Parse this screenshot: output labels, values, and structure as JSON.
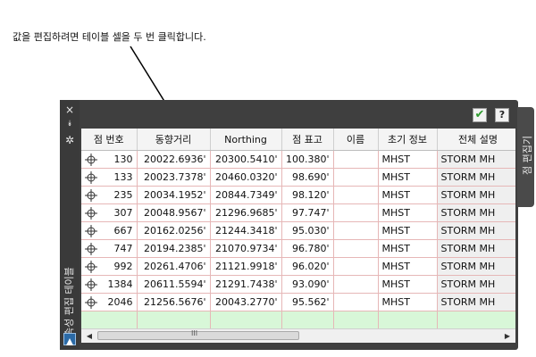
{
  "callout": {
    "text": "값을 편집하려면 테이블 셀을 두 번 클릭합니다."
  },
  "palette": {
    "title": "속성 편집 테이블",
    "side_tab_label": "점 편집기",
    "close_icon": "×",
    "pin_icon": "⯯",
    "settings_icon": "✲"
  },
  "toolbar": {
    "apply_icon": "check-icon",
    "help_label": "?"
  },
  "columns": [
    "점 번호",
    "동향거리",
    "Northing",
    "점 표고",
    "이름",
    "초기 정보",
    "전체 설명"
  ],
  "rows": [
    [
      "130",
      "20022.6936'",
      "20300.5410'",
      "100.380'",
      "",
      "MHST",
      "STORM MH"
    ],
    [
      "133",
      "20023.7378'",
      "20460.0320'",
      "98.690'",
      "",
      "MHST",
      "STORM MH"
    ],
    [
      "235",
      "20034.1952'",
      "20844.7349'",
      "98.120'",
      "",
      "MHST",
      "STORM MH"
    ],
    [
      "307",
      "20048.9567'",
      "21296.9685'",
      "97.747'",
      "",
      "MHST",
      "STORM MH"
    ],
    [
      "667",
      "20162.0256'",
      "21244.3418'",
      "95.030'",
      "",
      "MHST",
      "STORM MH"
    ],
    [
      "747",
      "20194.2385'",
      "21070.9734'",
      "96.780'",
      "",
      "MHST",
      "STORM MH"
    ],
    [
      "992",
      "20261.4706'",
      "21121.9918'",
      "96.020'",
      "",
      "MHST",
      "STORM MH"
    ],
    [
      "1384",
      "20611.5594'",
      "21291.7438'",
      "93.090'",
      "",
      "MHST",
      "STORM MH"
    ],
    [
      "2046",
      "21256.5676'",
      "20043.2770'",
      "95.562'",
      "",
      "MHST",
      "STORM MH"
    ]
  ],
  "scrollbar": {
    "left_arrow": "◀",
    "right_arrow": "▶",
    "grip": "III"
  },
  "colors": {
    "frame": "#3f3f3f",
    "grid_line": "#e6b7b7",
    "new_row": "#d8f7d8",
    "apply_check": "#2e9b2e"
  }
}
